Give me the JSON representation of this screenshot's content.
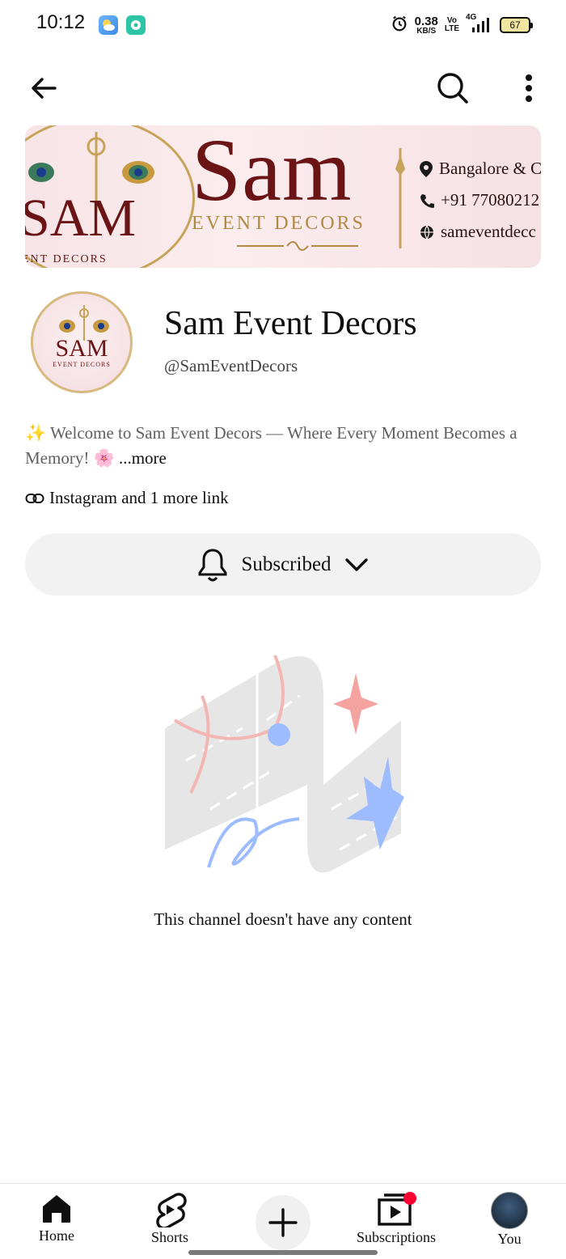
{
  "status_bar": {
    "time": "10:12",
    "net_speed_value": "0.38",
    "net_speed_unit": "KB/S",
    "volte_top": "Vo",
    "volte_bottom": "LTE",
    "network": "4G",
    "battery": "67"
  },
  "top_bar": {
    "back_icon": "arrow-left-icon",
    "search_icon": "search-icon",
    "more_icon": "more-vertical-icon"
  },
  "banner": {
    "left_brand": "SAM",
    "left_sub": "ENT DECORS",
    "title": "Sam",
    "subtitle": "EVENT DECORS",
    "location": "Bangalore & C",
    "phone": "+91 77080212",
    "website": "sameventdecc"
  },
  "channel": {
    "avatar_brand": "SAM",
    "avatar_sub": "EVENT DECORS",
    "name": "Sam Event Decors",
    "handle": "@SamEventDecors",
    "description": "✨ Welcome to Sam Event Decors — Where Every Moment Becomes a Memory! 🌸",
    "more_label": "...more",
    "links_text": "Instagram and 1 more link",
    "subscribe_label": "Subscribed"
  },
  "empty_state": {
    "message": "This channel doesn't have any content"
  },
  "bottom_nav": {
    "items": [
      {
        "label": "Home",
        "icon": "home-icon"
      },
      {
        "label": "Shorts",
        "icon": "shorts-icon"
      },
      {
        "label": "",
        "icon": "plus-icon"
      },
      {
        "label": "Subscriptions",
        "icon": "subscriptions-icon"
      },
      {
        "label": "You",
        "icon": "avatar"
      }
    ]
  },
  "colors": {
    "brand_maroon": "#6b1416",
    "brand_gold": "#b08a45",
    "notification_dot": "#ff0033",
    "button_bg": "#f2f2f2"
  }
}
